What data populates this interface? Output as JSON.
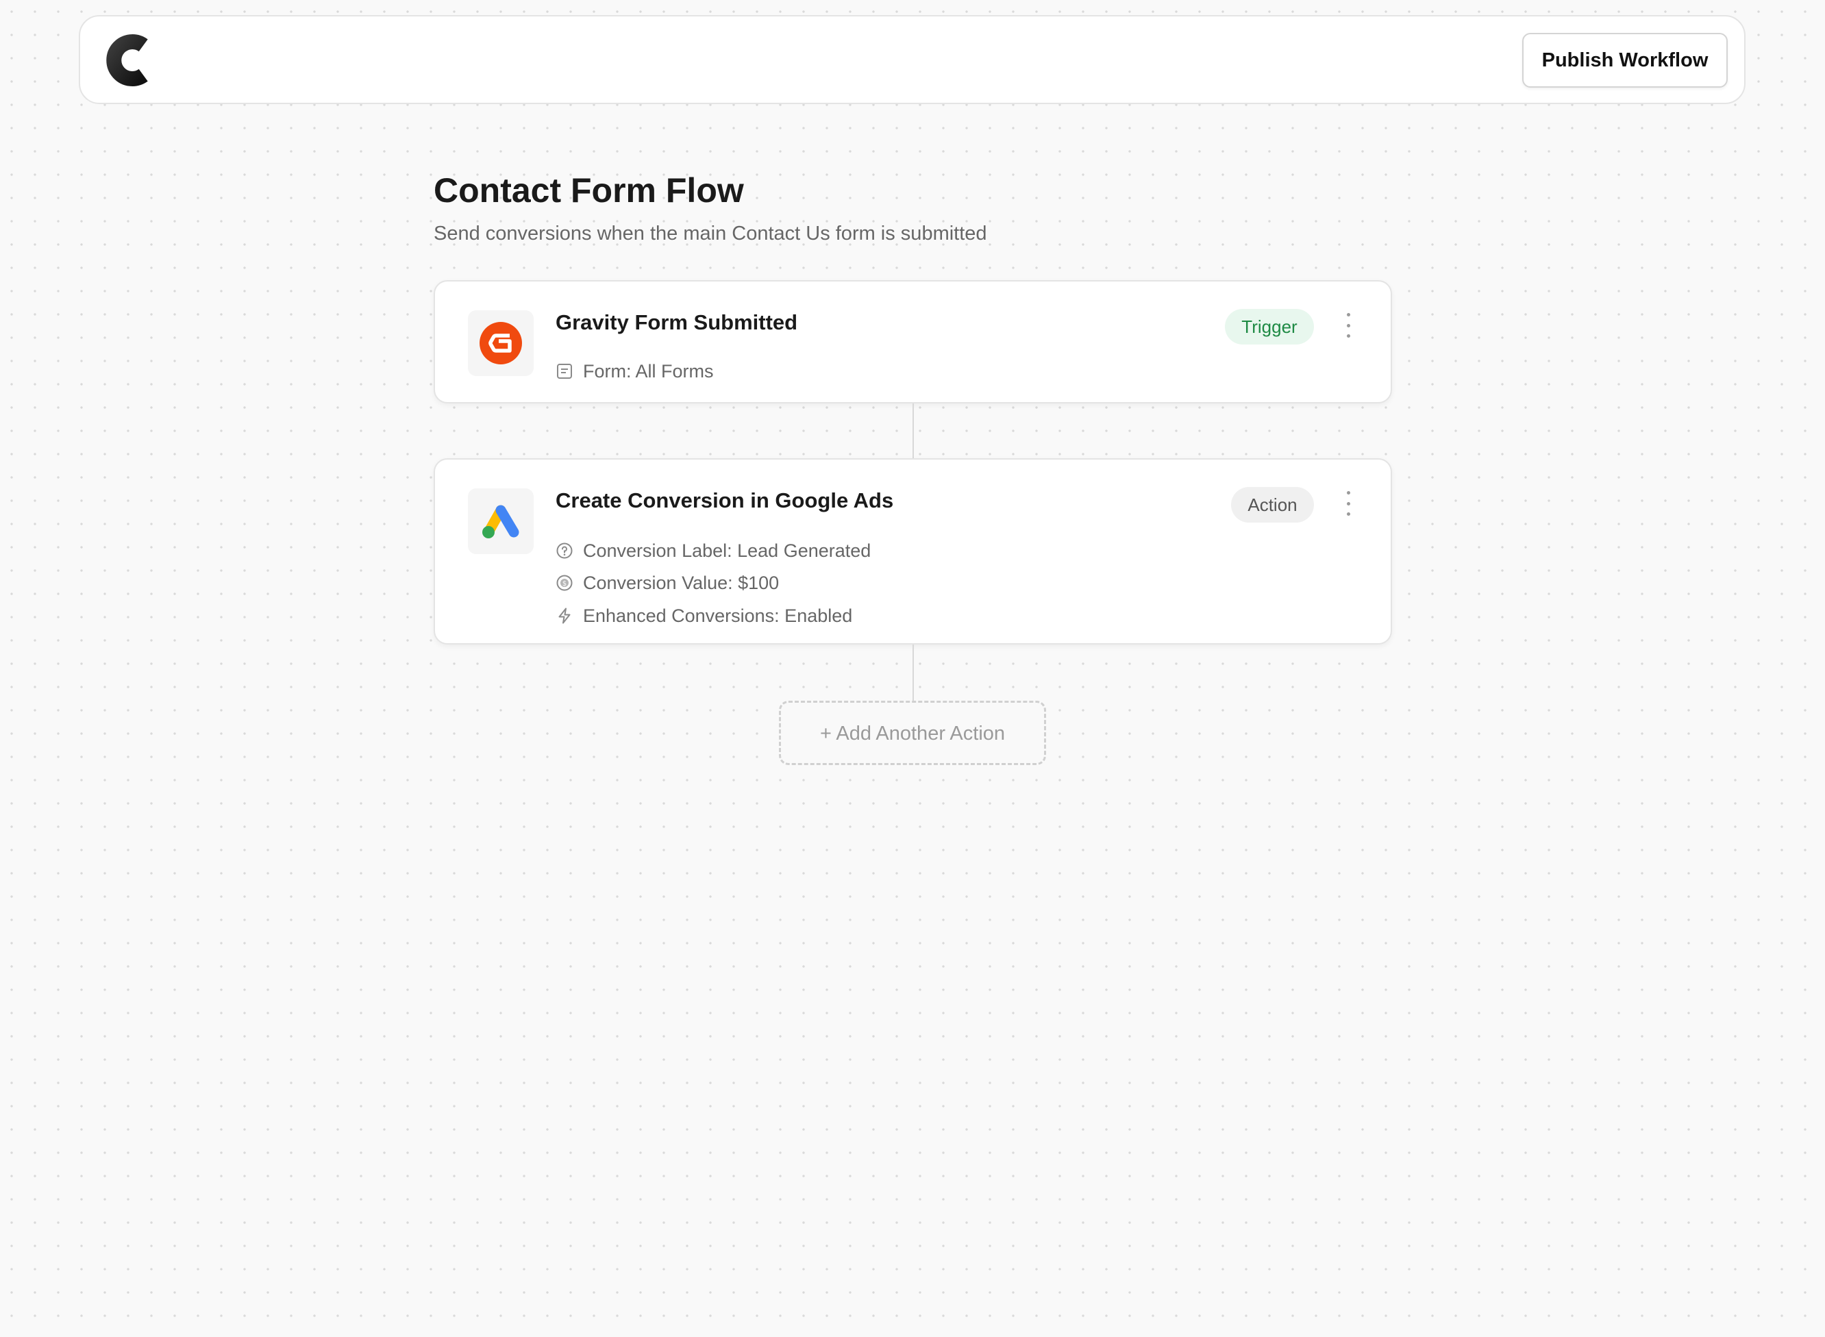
{
  "header": {
    "logo_icon": "c-logo-icon",
    "publish_label": "Publish Workflow"
  },
  "workflow": {
    "title": "Contact Form Flow",
    "subtitle": "Send conversions when the main Contact Us form is submitted"
  },
  "trigger": {
    "icon": "gravity-forms-icon",
    "title": "Gravity Form Submitted",
    "badge": "Trigger",
    "details": [
      {
        "icon": "form-icon",
        "text": "Form: All Forms"
      }
    ]
  },
  "action": {
    "icon": "google-ads-icon",
    "title": "Create Conversion in Google Ads",
    "badge": "Action",
    "details": [
      {
        "icon": "question-circle-icon",
        "text": "Conversion Label: Lead Generated"
      },
      {
        "icon": "dollar-circle-icon",
        "text": "Conversion Value: $100"
      },
      {
        "icon": "lightning-icon",
        "text": "Enhanced Conversions: Enabled"
      }
    ]
  },
  "add_action_label": "+ Add Another Action",
  "colors": {
    "accent_orange": "#f04a0f",
    "trigger_badge_bg": "#e8f7ee",
    "trigger_badge_text": "#1e8a44",
    "google_blue": "#4285f4",
    "google_yellow": "#fbbc04",
    "google_green": "#34a853"
  }
}
